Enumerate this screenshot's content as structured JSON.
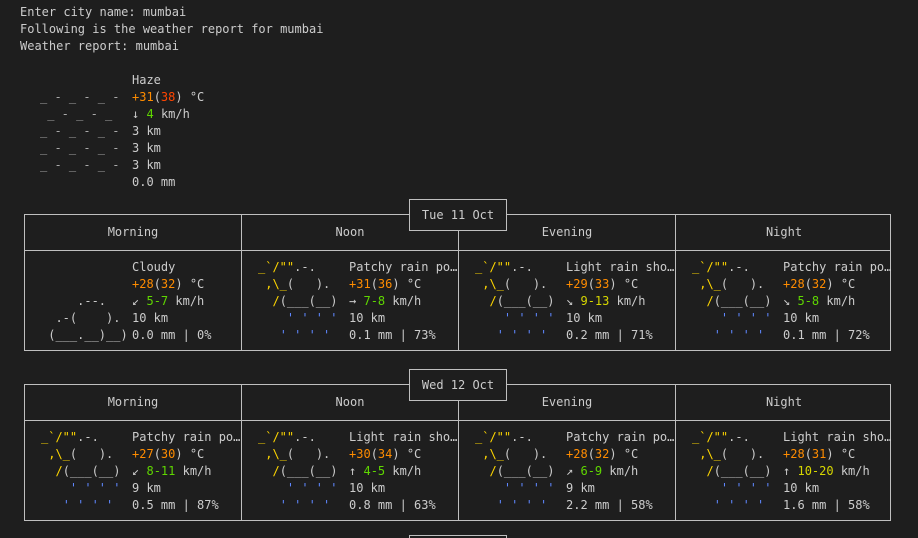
{
  "header": {
    "prompt": "Enter city name: mumbai",
    "following": "Following is the weather report for mumbai",
    "report": "Weather report: mumbai"
  },
  "current": {
    "condition": "Haze",
    "temp": "+31",
    "feels": "38",
    "unit": "°C",
    "wind_dir": "↓",
    "wind": "4",
    "wind_unit": "km/h",
    "visibility": "3 km",
    "extra1": "3 km",
    "extra2": "3 km",
    "precip": "0.0 mm"
  },
  "days": [
    {
      "date": "Tue 11 Oct",
      "periods": [
        "Morning",
        "Noon",
        "Evening",
        "Night"
      ],
      "cells": [
        {
          "cond": "Cloudy",
          "temp": "+28",
          "feels": "32",
          "wdir": "↙",
          "wind": "5-7",
          "vis": "10 km",
          "rain": "0.0 mm | 0%"
        },
        {
          "cond": "Patchy rain po…",
          "temp": "+31",
          "feels": "36",
          "wdir": "→",
          "wind": "7-8",
          "vis": "10 km",
          "rain": "0.1 mm | 73%"
        },
        {
          "cond": "Light rain sho…",
          "temp": "+29",
          "feels": "33",
          "wdir": "↘",
          "wind": "9-13",
          "vis": "10 km",
          "rain": "0.2 mm | 71%"
        },
        {
          "cond": "Patchy rain po…",
          "temp": "+28",
          "feels": "32",
          "wdir": "↘",
          "wind": "5-8",
          "vis": "10 km",
          "rain": "0.1 mm | 72%"
        }
      ]
    },
    {
      "date": "Wed 12 Oct",
      "periods": [
        "Morning",
        "Noon",
        "Evening",
        "Night"
      ],
      "cells": [
        {
          "cond": "Patchy rain po…",
          "temp": "+27",
          "feels": "30",
          "wdir": "↙",
          "wind": "8-11",
          "vis": "9 km",
          "rain": "0.5 mm | 87%"
        },
        {
          "cond": "Light rain sho…",
          "temp": "+30",
          "feels": "34",
          "wdir": "↑",
          "wind": "4-5",
          "vis": "10 km",
          "rain": "0.8 mm | 63%"
        },
        {
          "cond": "Patchy rain po…",
          "temp": "+28",
          "feels": "32",
          "wdir": "↗",
          "wind": "6-9",
          "vis": "9 km",
          "rain": "2.2 mm | 58%"
        },
        {
          "cond": "Light rain sho…",
          "temp": "+28",
          "feels": "31",
          "wdir": "↑",
          "wind": "10-20",
          "vis": "10 km",
          "rain": "1.6 mm | 58%"
        }
      ]
    }
  ],
  "colors": {
    "sun": "#ffd700",
    "rain": "#5f87ff",
    "temp_warm": "#ff8c00",
    "temp_hot": "#ff4500",
    "wind_low": "#5fd700"
  }
}
